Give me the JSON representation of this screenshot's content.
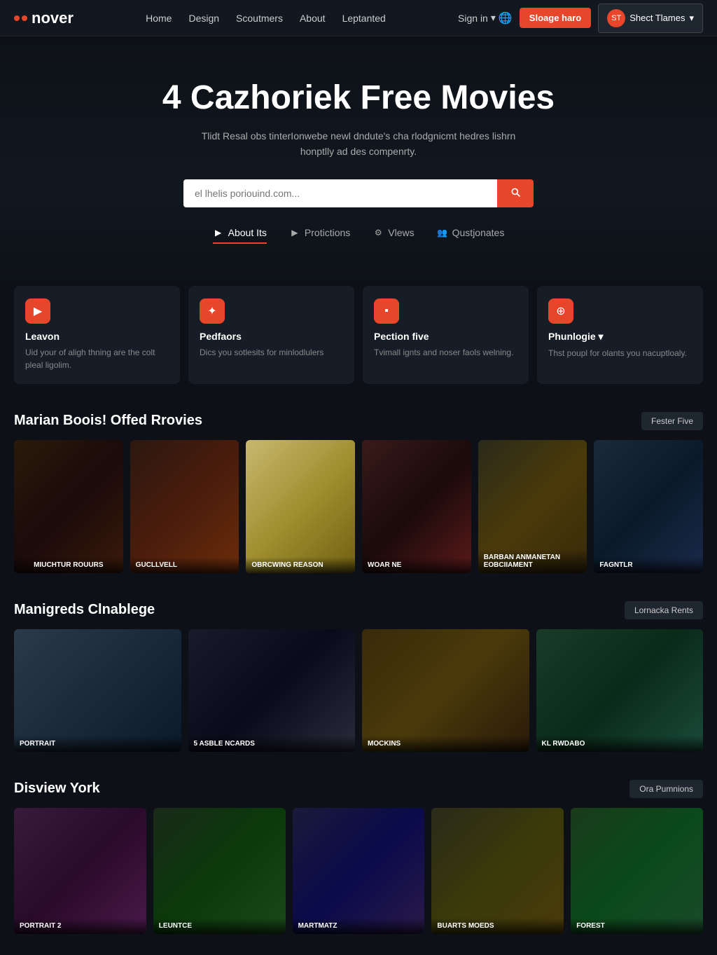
{
  "nav": {
    "logo_text": "nover",
    "links": [
      "Home",
      "Design",
      "Scoutmers",
      "About",
      "Leptanted"
    ],
    "signin_label": "Sign in",
    "cta_label": "Sloage haro",
    "profile_label": "Shect Tlames",
    "chevron": "▾"
  },
  "hero": {
    "title": "4 Cazhoriek Free Movies",
    "subtitle": "Tlidt Resal obs tinterIonwebe newl dndute's cha rlodgnicmt hedres lishrn honptlly ad des compenrty.",
    "search_placeholder": "el lhelis poriouind.com...",
    "search_btn_label": "🔍"
  },
  "tabs": [
    {
      "id": "about",
      "label": "About Its",
      "active": true,
      "icon": "▶"
    },
    {
      "id": "promotions",
      "label": "Protictions",
      "active": false,
      "icon": "▶"
    },
    {
      "id": "views",
      "label": "Vlews",
      "active": false,
      "icon": "⚙"
    },
    {
      "id": "questions",
      "label": "Qustjonates",
      "active": false,
      "icon": "👥"
    }
  ],
  "features": [
    {
      "id": "leavon",
      "icon": "▶",
      "title": "Leavon",
      "desc": "Uid your of aligh thning are the colt pleal ligolim."
    },
    {
      "id": "pedfaors",
      "icon": "✦",
      "title": "Pedfaors",
      "desc": "Dics you sotlesits for minlodlulers"
    },
    {
      "id": "pection-five",
      "icon": "▪",
      "title": "Pection five",
      "desc": "Tvimall ignts and noser faols welning."
    },
    {
      "id": "phunlogie",
      "icon": "⊕",
      "title": "Phunlogie ▾",
      "desc": "Thst poupl for olants you nacuptloaly."
    }
  ],
  "sections": [
    {
      "id": "marian-boois",
      "title": "Marian Boois! Offed Rrovies",
      "btn_label": "Fester Five",
      "movies": [
        {
          "id": "m1",
          "title": "MIUCHTUR ROUURS",
          "color": "mc1"
        },
        {
          "id": "m2",
          "title": "GUCLLVELL",
          "color": "mc2"
        },
        {
          "id": "m3",
          "title": "Obrcwing Reason",
          "color": "mc3"
        },
        {
          "id": "m4",
          "title": "WOAR NE",
          "color": "mc4"
        },
        {
          "id": "m5",
          "title": "BARBAN ANMANETAN EOBCIIAMENT",
          "color": "mc5"
        },
        {
          "id": "m6",
          "title": "FAGNTLR",
          "color": "mc6"
        }
      ]
    },
    {
      "id": "manigreds",
      "title": "Manigreds Clnablege",
      "btn_label": "Lornacka Rents",
      "movies": [
        {
          "id": "m7",
          "title": "Portrait",
          "color": "mc7"
        },
        {
          "id": "m8",
          "title": "5 ASBLE NCARDS",
          "color": "mc8"
        },
        {
          "id": "m9",
          "title": "MOCKINS",
          "color": "mc9"
        },
        {
          "id": "m10",
          "title": "KL RWDABO",
          "color": "mc10"
        }
      ]
    },
    {
      "id": "disview-york",
      "title": "Disview York",
      "btn_label": "Ora Pumnions",
      "movies": [
        {
          "id": "m11",
          "title": "Portrait 2",
          "color": "mc1"
        },
        {
          "id": "m12",
          "title": "Leuntce",
          "color": "mc2"
        },
        {
          "id": "m13",
          "title": "MARTMATZ",
          "color": "mc3"
        },
        {
          "id": "m14",
          "title": "BUARTS MOEDS",
          "color": "mc4"
        },
        {
          "id": "m15",
          "title": "Forest",
          "color": "mc5"
        }
      ]
    }
  ]
}
